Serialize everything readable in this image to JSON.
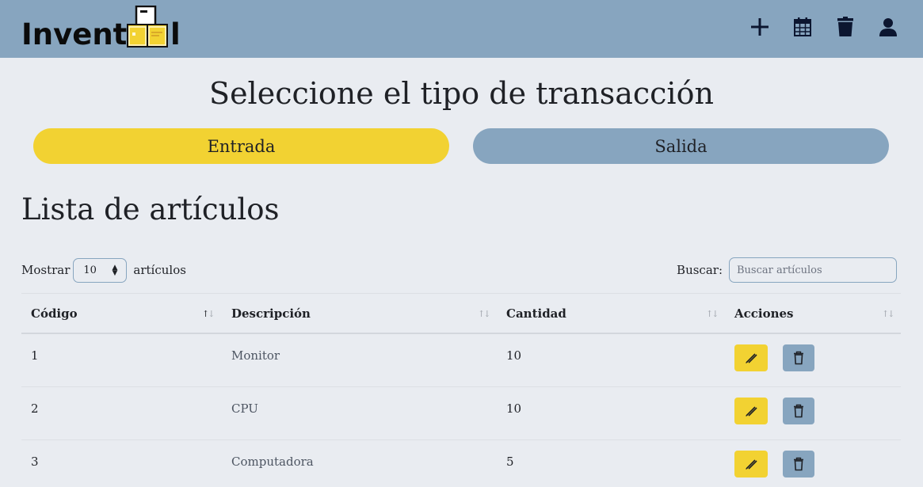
{
  "brand": {
    "logo_text": "Invent",
    "logo_text_tail": "l"
  },
  "nav": [
    {
      "icon": "plus-icon"
    },
    {
      "icon": "calendar-icon"
    },
    {
      "icon": "trash-icon"
    },
    {
      "icon": "user-icon"
    }
  ],
  "page_title": "Seleccione el tipo de transacción",
  "transaction_buttons": {
    "entrada": "Entrada",
    "salida": "Salida"
  },
  "list_title": "Lista de artículos",
  "length_control": {
    "prefix": "Mostrar",
    "value": "10",
    "suffix": "artículos"
  },
  "search": {
    "label": "Buscar:",
    "placeholder": "Buscar artículos"
  },
  "table": {
    "columns": [
      "Código",
      "Descripción",
      "Cantidad",
      "Acciones"
    ],
    "rows": [
      {
        "codigo": "1",
        "descripcion": "Monitor",
        "cantidad": "10"
      },
      {
        "codigo": "2",
        "descripcion": "CPU",
        "cantidad": "10"
      },
      {
        "codigo": "3",
        "descripcion": "Computadora",
        "cantidad": "5"
      }
    ]
  },
  "colors": {
    "header": "#87a5bf",
    "accent_yellow": "#f2d232",
    "background": "#e9ecf1"
  }
}
